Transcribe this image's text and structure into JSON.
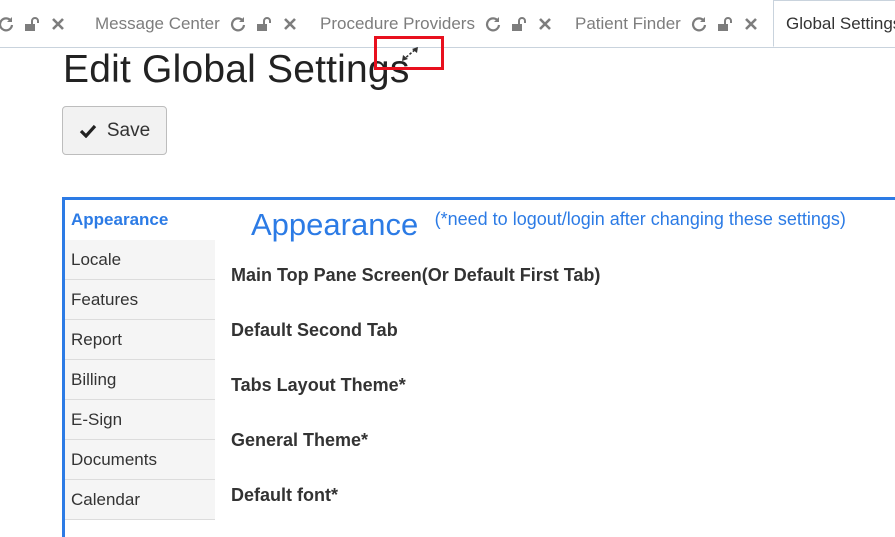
{
  "tabs": [
    {
      "title": "Message Center"
    },
    {
      "title": "Procedure Providers"
    },
    {
      "title": "Patient Finder"
    },
    {
      "title": "Global Settings"
    }
  ],
  "icons": {
    "refresh": "refresh-icon",
    "unlock": "unlock-icon",
    "close": "close-icon",
    "check": "check-icon",
    "resize": "resize-icon"
  },
  "page": {
    "title": "Edit Global Settings"
  },
  "toolbar": {
    "save_label": "Save"
  },
  "settings_nav": [
    {
      "label": "Appearance"
    },
    {
      "label": "Locale"
    },
    {
      "label": "Features"
    },
    {
      "label": "Report"
    },
    {
      "label": "Billing"
    },
    {
      "label": "E-Sign"
    },
    {
      "label": "Documents"
    },
    {
      "label": "Calendar"
    }
  ],
  "section": {
    "title": "Appearance",
    "note": "(*need to logout/login after changing these settings)"
  },
  "fields": [
    {
      "label": "Main Top Pane Screen(Or Default First Tab)"
    },
    {
      "label": "Default Second Tab"
    },
    {
      "label": "Tabs Layout Theme*"
    },
    {
      "label": "General Theme*"
    },
    {
      "label": "Default font*"
    }
  ],
  "colors": {
    "accent": "#2c7be5",
    "highlight": "#e8101e",
    "tab_text": "#7d7d7d"
  }
}
